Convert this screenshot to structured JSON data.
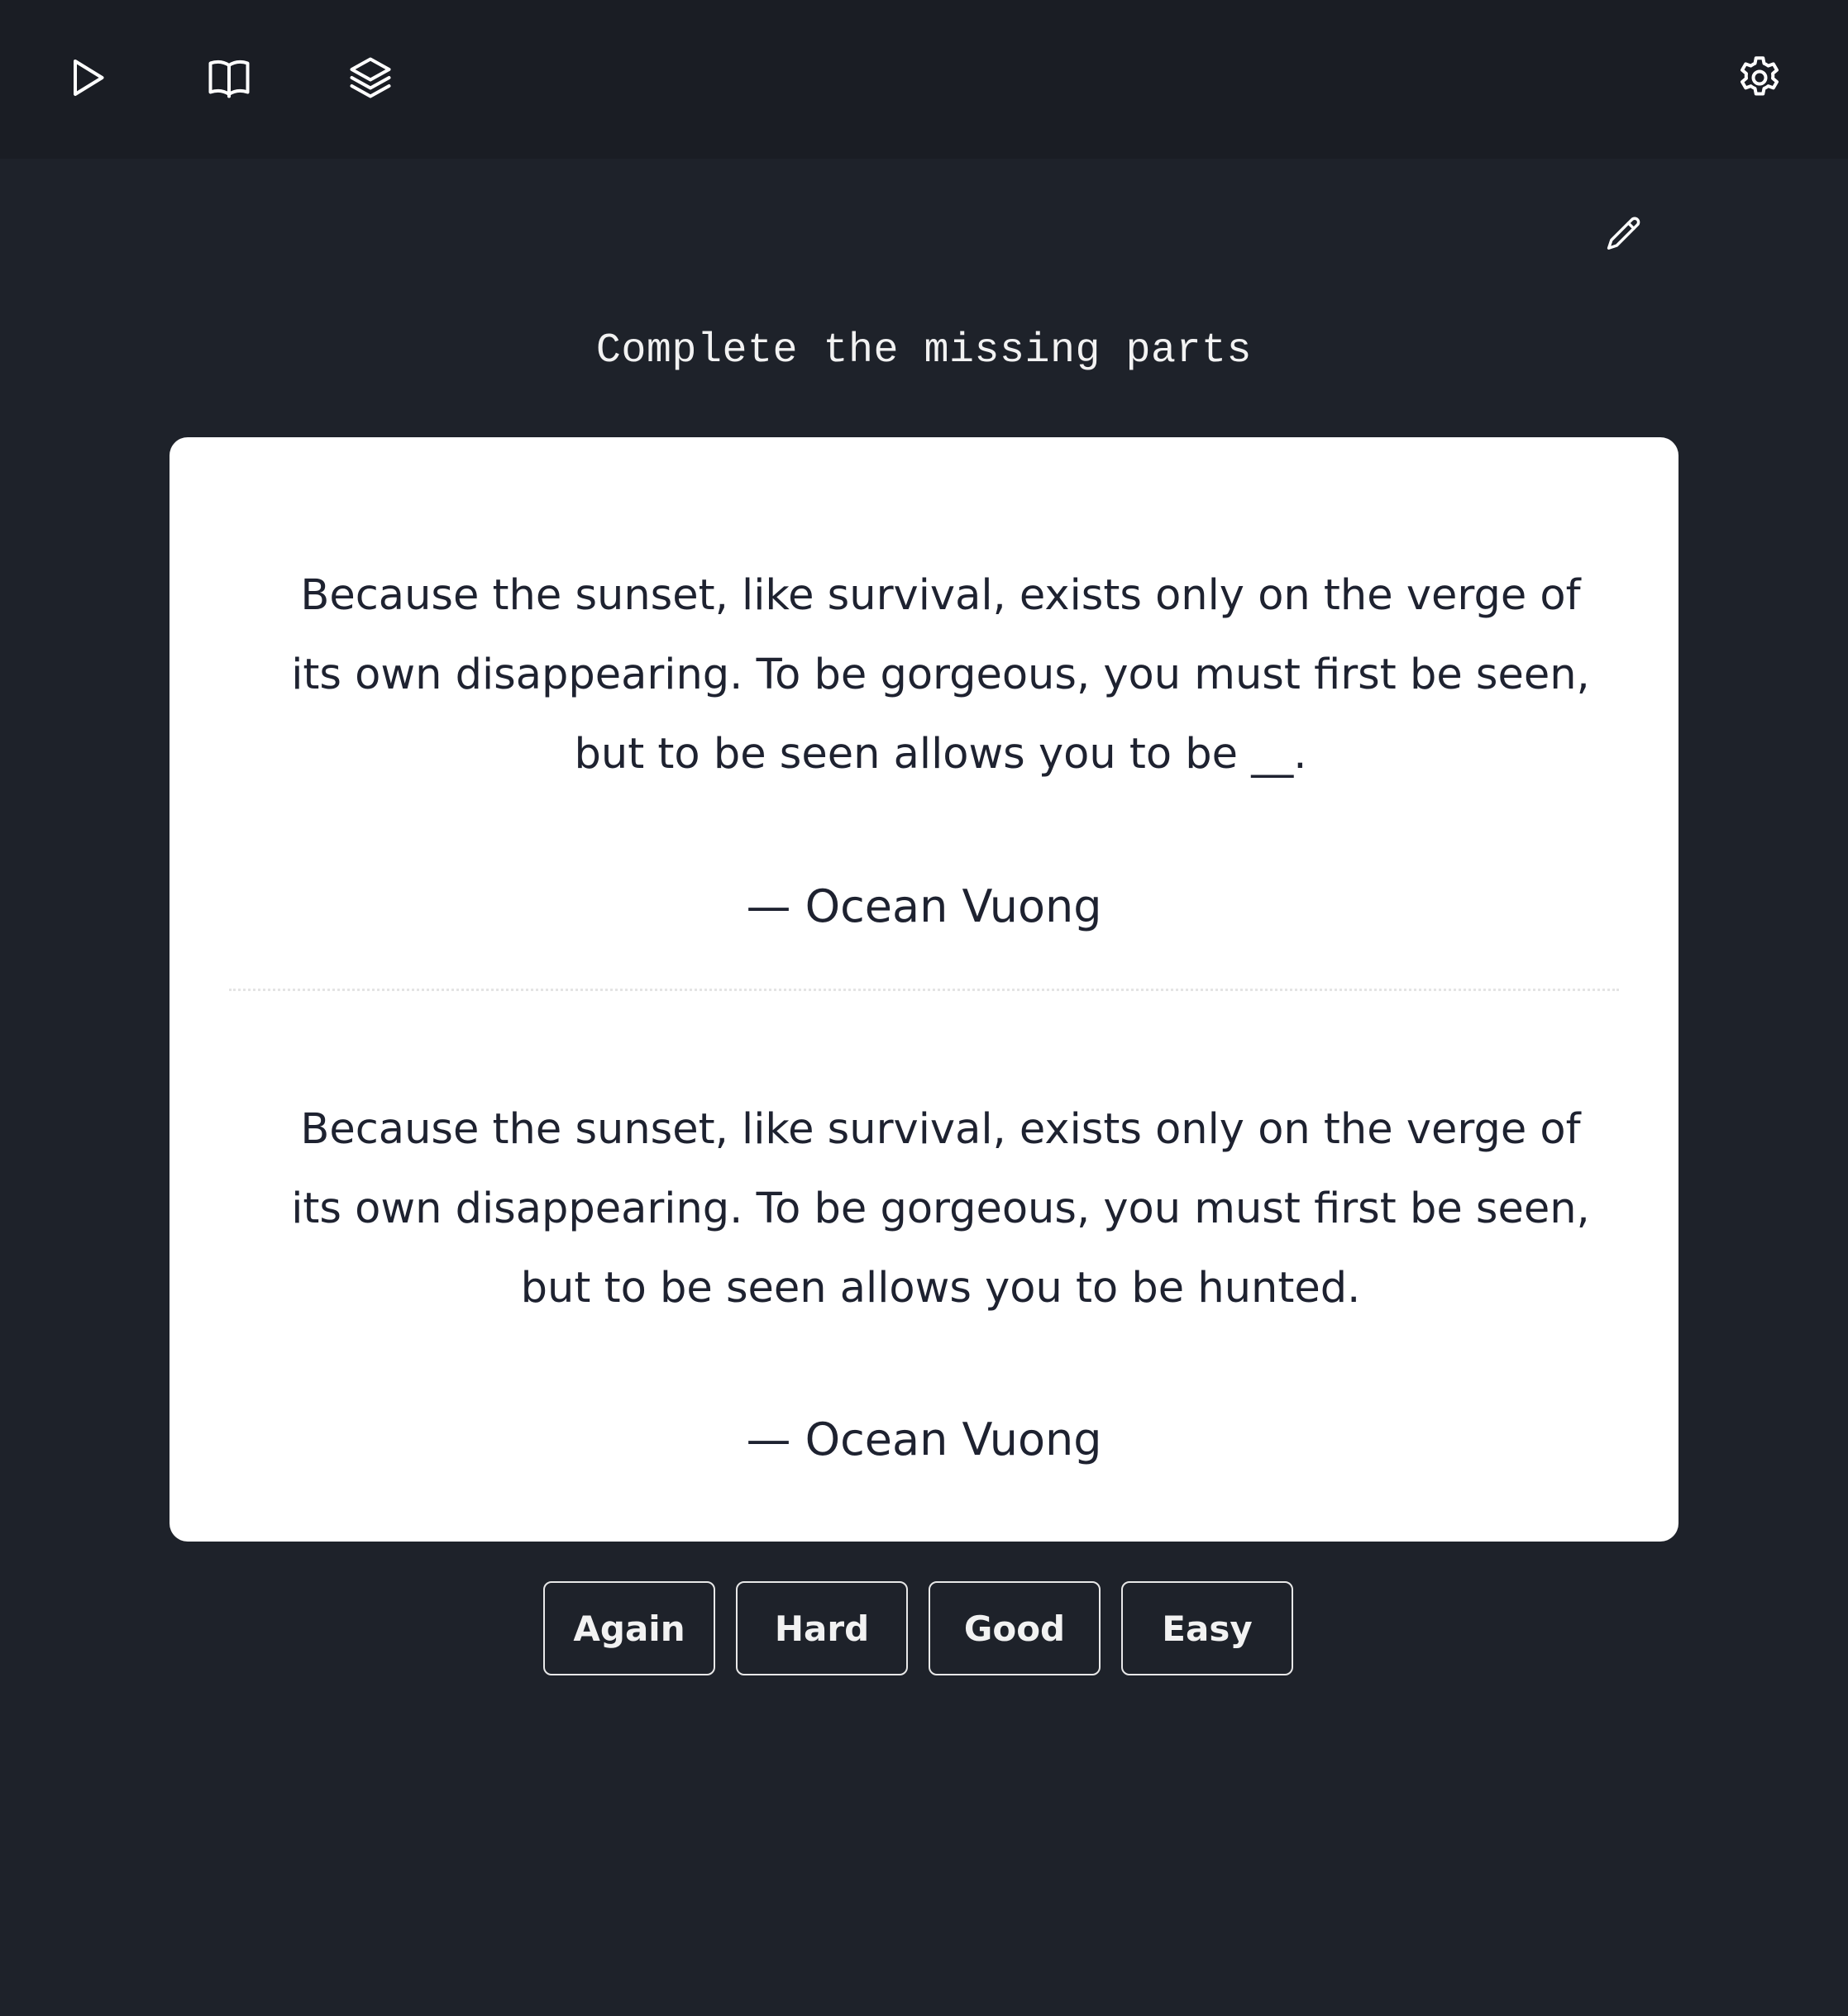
{
  "toolbar": {
    "icons": [
      "play-icon",
      "book-open-icon",
      "layers-icon",
      "settings-gear-icon"
    ]
  },
  "card_header": {
    "edit_icon": "pencil-icon",
    "prompt": "Complete the missing parts"
  },
  "card": {
    "front": {
      "quote": "Because the sunset, like survival, exists only on the verge of its own disappearing. To be gorgeous, you must first be seen, but to be seen allows you to be __.",
      "author": "— Ocean Vuong"
    },
    "back": {
      "quote": "Because the sunset, like survival, exists only on the verge of its own disappearing. To be gorgeous, you must first be seen, but to be seen allows you to be hunted.",
      "author": "— Ocean Vuong"
    }
  },
  "answer_buttons": {
    "again": "Again",
    "hard": "Hard",
    "good": "Good",
    "easy": "Easy"
  },
  "colors": {
    "background": "#1e222a",
    "topbar": "#1a1d24",
    "card": "#ffffff",
    "text_dark": "#1e2230",
    "text_light": "#f2f2f2"
  }
}
